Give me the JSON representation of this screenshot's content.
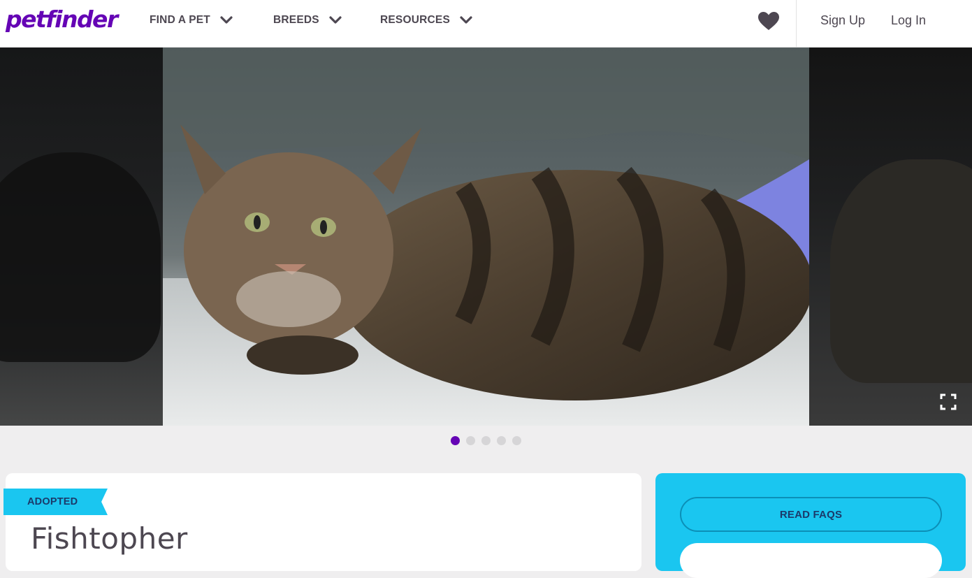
{
  "header": {
    "logo": "petfinder",
    "nav": [
      {
        "label": "FIND A PET"
      },
      {
        "label": "BREEDS"
      },
      {
        "label": "RESOURCES"
      }
    ],
    "sign_up": "Sign Up",
    "log_in": "Log In"
  },
  "carousel": {
    "image_count": 5,
    "active_index": 0
  },
  "pet": {
    "status": "ADOPTED",
    "name": "Fishtopher"
  },
  "sidebar": {
    "faq_button": "READ FAQS"
  },
  "colors": {
    "brand_purple": "#6504b5",
    "accent_cyan": "#1ac6f0",
    "text_dark": "#4d4751"
  },
  "icons": [
    "chevron-down-icon",
    "heart-icon",
    "expand-icon"
  ]
}
